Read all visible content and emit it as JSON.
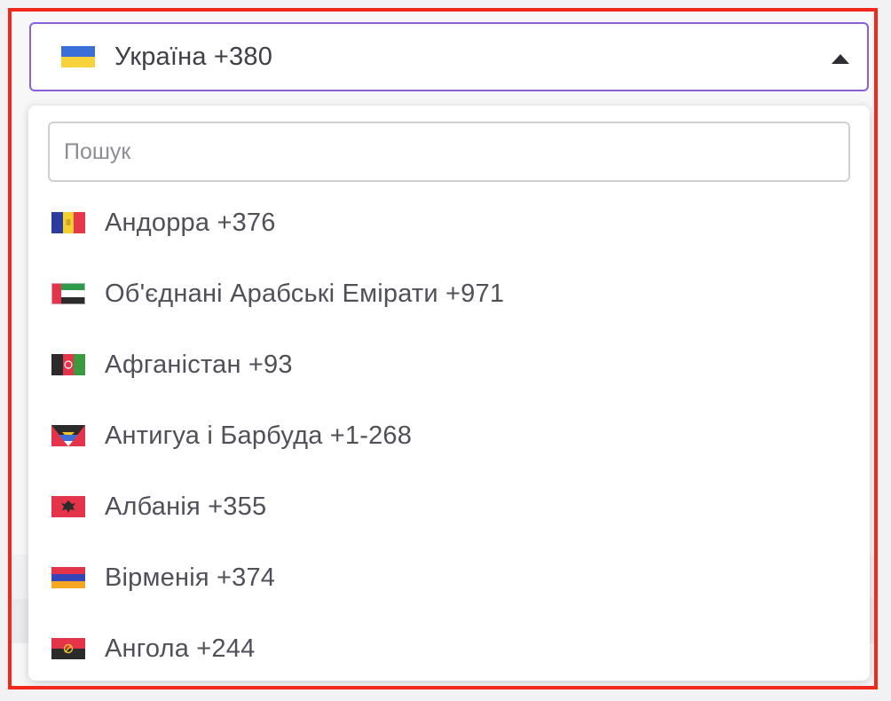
{
  "selected": {
    "country": "Україна",
    "code": "+380",
    "label": "Україна +380",
    "flag_icon": "ukraine-flag-icon"
  },
  "search": {
    "placeholder": "Пошук",
    "value": ""
  },
  "items": [
    {
      "label": "Андорра +376",
      "flag_icon": "andorra-flag-icon"
    },
    {
      "label": "Об'єднані Арабські Емірати +971",
      "flag_icon": "uae-flag-icon"
    },
    {
      "label": "Афганістан +93",
      "flag_icon": "afghanistan-flag-icon"
    },
    {
      "label": "Антигуа і Барбуда +1-268",
      "flag_icon": "antigua-barbuda-flag-icon"
    },
    {
      "label": "Албанія +355",
      "flag_icon": "albania-flag-icon"
    },
    {
      "label": "Вірменія +374",
      "flag_icon": "armenia-flag-icon"
    },
    {
      "label": "Ангола +244",
      "flag_icon": "angola-flag-icon"
    }
  ],
  "colors": {
    "highlight_border": "#f2281a",
    "select_border": "#8b5fe0",
    "text": "#505058"
  }
}
